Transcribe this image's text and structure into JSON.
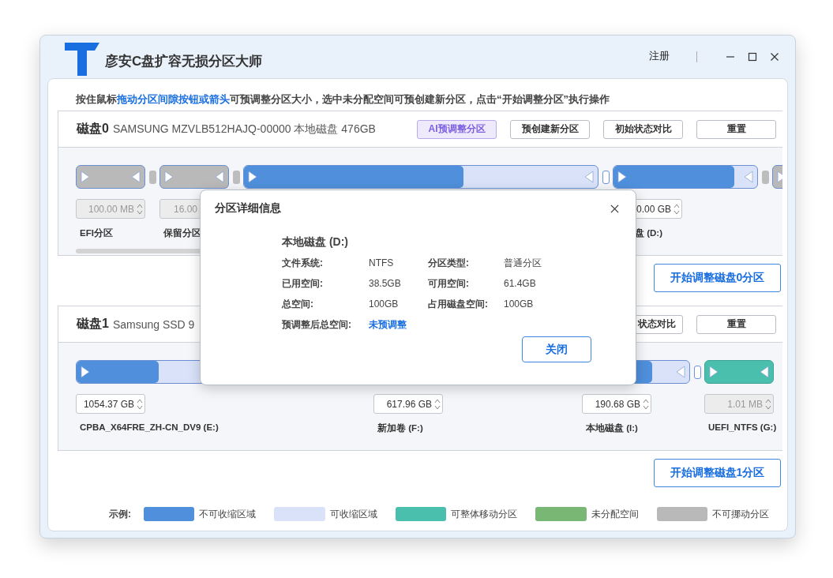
{
  "window": {
    "title": "彦安C盘扩容无损分区大师",
    "register": "注册"
  },
  "hint": "按住鼠标**拖动分区间隙按钮或箭头**可预调整分区大小，选中未分配空间可预创建新分区，点击“开始调整分区”执行操作",
  "disks": [
    {
      "title": "磁盘0",
      "description": "SAMSUNG MZVLB512HAJQ-00000 本地磁盘 476GB",
      "has_scrollbar": true,
      "buttons": [
        {
          "label": "AI预调整分区",
          "kind": "ai"
        },
        {
          "label": "预创建新分区",
          "kind": "plain"
        },
        {
          "label": "初始状态对比",
          "kind": "plain"
        },
        {
          "label": "重置",
          "kind": "plain"
        }
      ],
      "partitions": [
        {
          "kind": "locked",
          "size": "100.00 MB",
          "size_disabled": true,
          "label": "EFI分区"
        },
        {
          "kind": "locked",
          "size": "16.00",
          "size_disabled": true,
          "label": "保留分区"
        },
        {
          "kind": "resizable",
          "level": 0.62
        },
        {
          "kind": "resizable",
          "level": 0.84,
          "size": "0.00 GB",
          "size_disabled": false,
          "label": "盘 (D:)"
        },
        {
          "kind": "locked"
        }
      ],
      "start_button": "开始调整磁盘0分区"
    },
    {
      "title": "磁盘1",
      "description": "Samsung SSD 9",
      "has_scrollbar": false,
      "buttons": [
        {
          "label": "状态对比",
          "kind": "plain"
        },
        {
          "label": "重置",
          "kind": "plain"
        }
      ],
      "partitions": [
        {
          "kind": "resizable",
          "level": 0.29,
          "size": "1054.37 GB",
          "size_disabled": false,
          "label": "CPBA_X64FRE_ZH-CN_DV9 (E:)"
        },
        {
          "kind": "resizable",
          "size": "617.96 GB",
          "size_disabled": false,
          "label": "新加卷 (F:)"
        },
        {
          "kind": "resizable",
          "level": 0.65,
          "size": "190.68 GB",
          "size_disabled": false,
          "label": "本地磁盘 (I:)"
        },
        {
          "kind": "movable",
          "size": "1.01 MB",
          "size_disabled": true,
          "label": "UEFI_NTFS (G:)"
        }
      ],
      "start_button": "开始调整磁盘1分区"
    }
  ],
  "legend": {
    "title": "示例:",
    "items": [
      {
        "label": "不可收缩区域",
        "color": "#4f8fdb"
      },
      {
        "label": "可收缩区域",
        "color": "#d9e2f8"
      },
      {
        "label": "可整体移动分区",
        "color": "#4bbfad"
      },
      {
        "label": "未分配空间",
        "color": "#78b874"
      },
      {
        "label": "不可挪动分区",
        "color": "#b9b9b9"
      }
    ]
  },
  "dialog": {
    "title": "分区详细信息",
    "heading": "本地磁盘 (D:)",
    "fields": [
      {
        "label": "文件系统:",
        "value": "NTFS",
        "kind": "plain"
      },
      {
        "label": "分区类型:",
        "value": "普通分区",
        "kind": "plain"
      },
      {
        "label": "已用空间:",
        "value": "38.5GB",
        "kind": "plain"
      },
      {
        "label": "可用空间:",
        "value": "61.4GB",
        "kind": "plain"
      },
      {
        "label": "总空间:",
        "value": "100GB",
        "kind": "plain"
      },
      {
        "label": "占用磁盘空间:",
        "value": "100GB",
        "kind": "plain"
      },
      {
        "label": "预调整后总空间:",
        "value": "未预调整",
        "kind": "status"
      }
    ],
    "close_button": "关闭"
  }
}
